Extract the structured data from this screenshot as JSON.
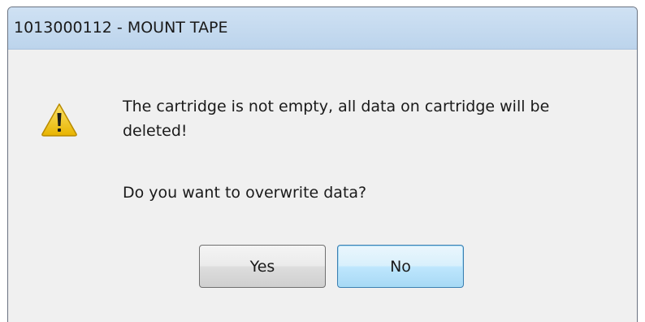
{
  "window": {
    "title": "1013000112 - MOUNT TAPE"
  },
  "icon": {
    "name": "warning-icon",
    "colors": {
      "fill_light": "#fbe36b",
      "fill_dark": "#e8b400",
      "stroke": "#b88a00",
      "glyph": "#1a1a1a"
    }
  },
  "message": {
    "text": "The cartridge is not empty, all data on cartridge will be deleted!",
    "question": "Do you want to overwrite data?"
  },
  "buttons": {
    "yes_label": "Yes",
    "no_label": "No"
  },
  "colors": {
    "titlebar": "#bcd4ec",
    "body": "#f0f0f0",
    "focus_border": "#3c7fb1"
  }
}
